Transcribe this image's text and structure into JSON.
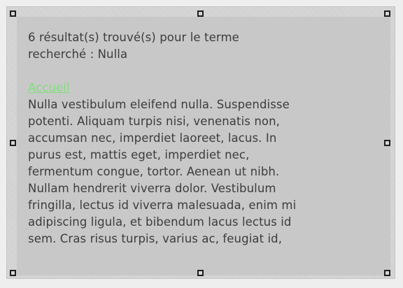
{
  "search": {
    "summary_lines": [
      "6 résultat(s) trouvé(s) pour le terme",
      "recherché : Nulla"
    ]
  },
  "result": {
    "link_label": "Accueil",
    "excerpt_lines": [
      "Nulla vestibulum eleifend nulla. Suspendisse",
      "potenti. Aliquam turpis nisi, venenatis non,",
      "accumsan nec, imperdiet laoreet, lacus. In",
      "purus est, mattis eget, imperdiet nec,",
      "fermentum congue, tortor. Aenean ut nibh.",
      "Nullam hendrerit viverra dolor. Vestibulum",
      "fringilla, lectus id viverra malesuada, enim mi",
      "adipiscing ligula, et bibendum lacus lectus id",
      "sem. Cras risus turpis, varius ac, feugiat id,"
    ]
  },
  "colors": {
    "link": "#7fe07a",
    "text": "#3c3c3c",
    "panel": "#c8c8c8",
    "handle_border": "#1e1e1e"
  }
}
